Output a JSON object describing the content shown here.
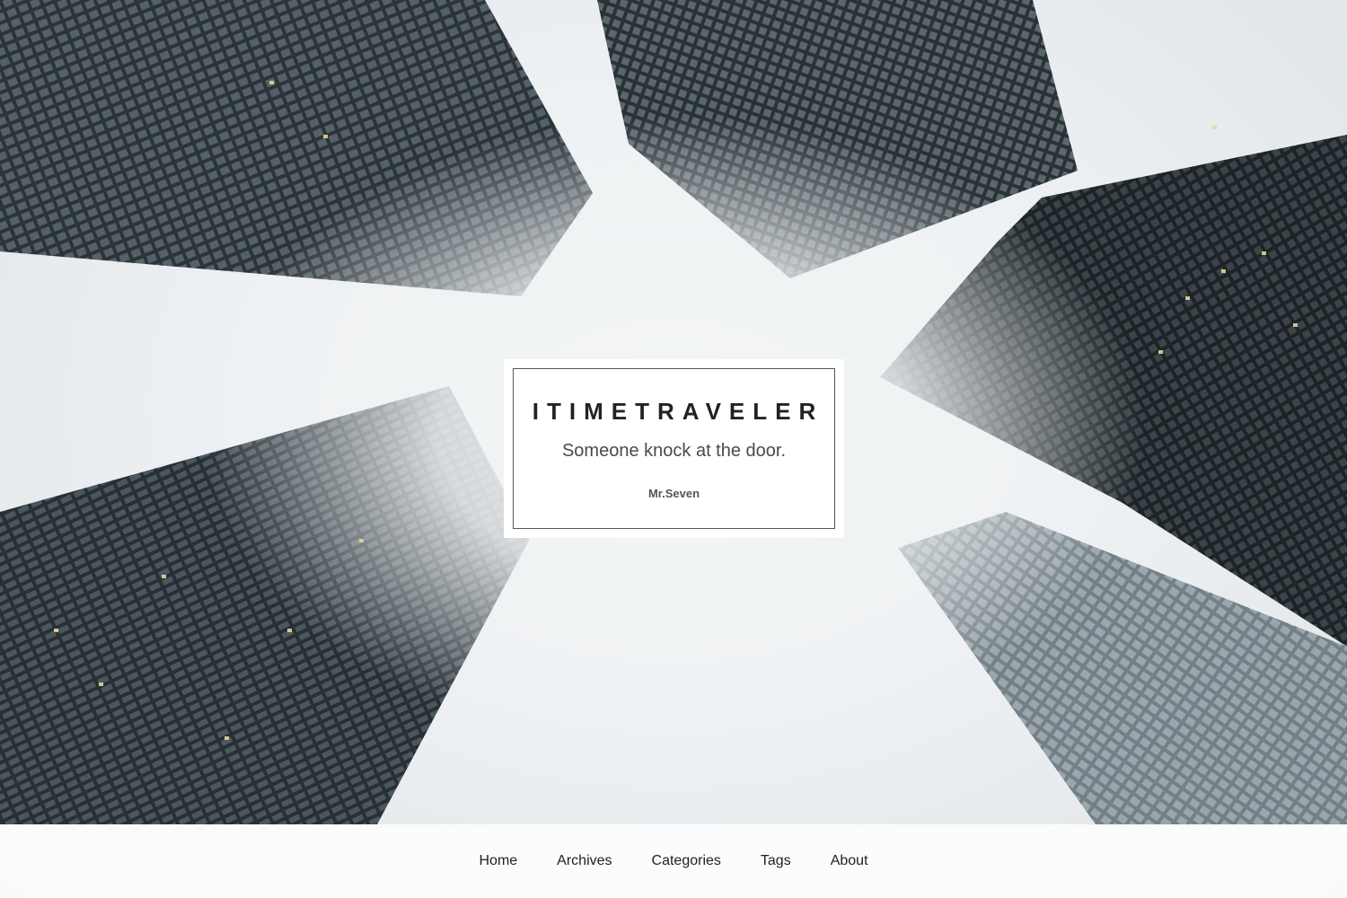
{
  "header": {
    "title": "ITIMETRAVELER",
    "subtitle": "Someone knock at the door.",
    "author": "Mr.Seven"
  },
  "nav": {
    "items": [
      {
        "label": "Home"
      },
      {
        "label": "Archives"
      },
      {
        "label": "Categories"
      },
      {
        "label": "Tags"
      },
      {
        "label": "About"
      }
    ]
  },
  "background": {
    "image_subject": "skyscrapers-looking-up-fog",
    "colors": {
      "sky": "#eef1f3",
      "building_dark": "#2a3136",
      "building_mid": "#4a565d",
      "window_light": "#e8d49a"
    }
  }
}
